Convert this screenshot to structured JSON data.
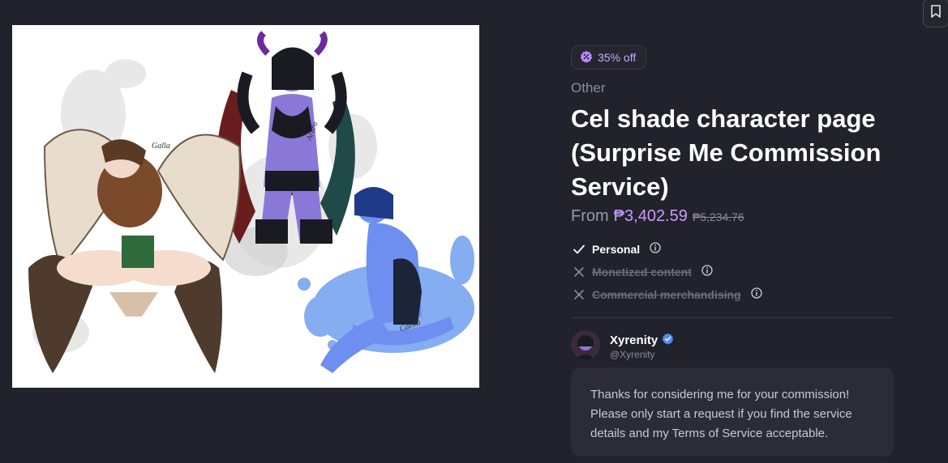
{
  "artwork": {
    "signatures": [
      "Galla",
      "Aruru",
      "Caelia"
    ]
  },
  "product": {
    "discount_label": "35% off",
    "category": "Other",
    "title": "Cel shade character page (Surprise Me Commission Service)",
    "price_prefix": "From",
    "price_current": "₱3,402.59",
    "price_original": "₱5,234.76"
  },
  "licenses": [
    {
      "label": "Personal",
      "included": true
    },
    {
      "label": "Monetized content",
      "included": false
    },
    {
      "label": "Commercial merchandising",
      "included": false
    }
  ],
  "creator": {
    "name": "Xyrenity",
    "handle": "@Xyrenity"
  },
  "message": "Thanks for considering me for your commission! Please only start a request if you find the service details and my Terms of Service acceptable.",
  "colors": {
    "background": "#22222c",
    "accent": "#c79cff",
    "verified": "#4a8ff5"
  },
  "icons": {
    "bookmark": "bookmark-icon",
    "discount": "badge-percent-icon",
    "included": "check-icon",
    "excluded": "x-icon",
    "info": "info-icon",
    "verified": "verified-icon"
  }
}
